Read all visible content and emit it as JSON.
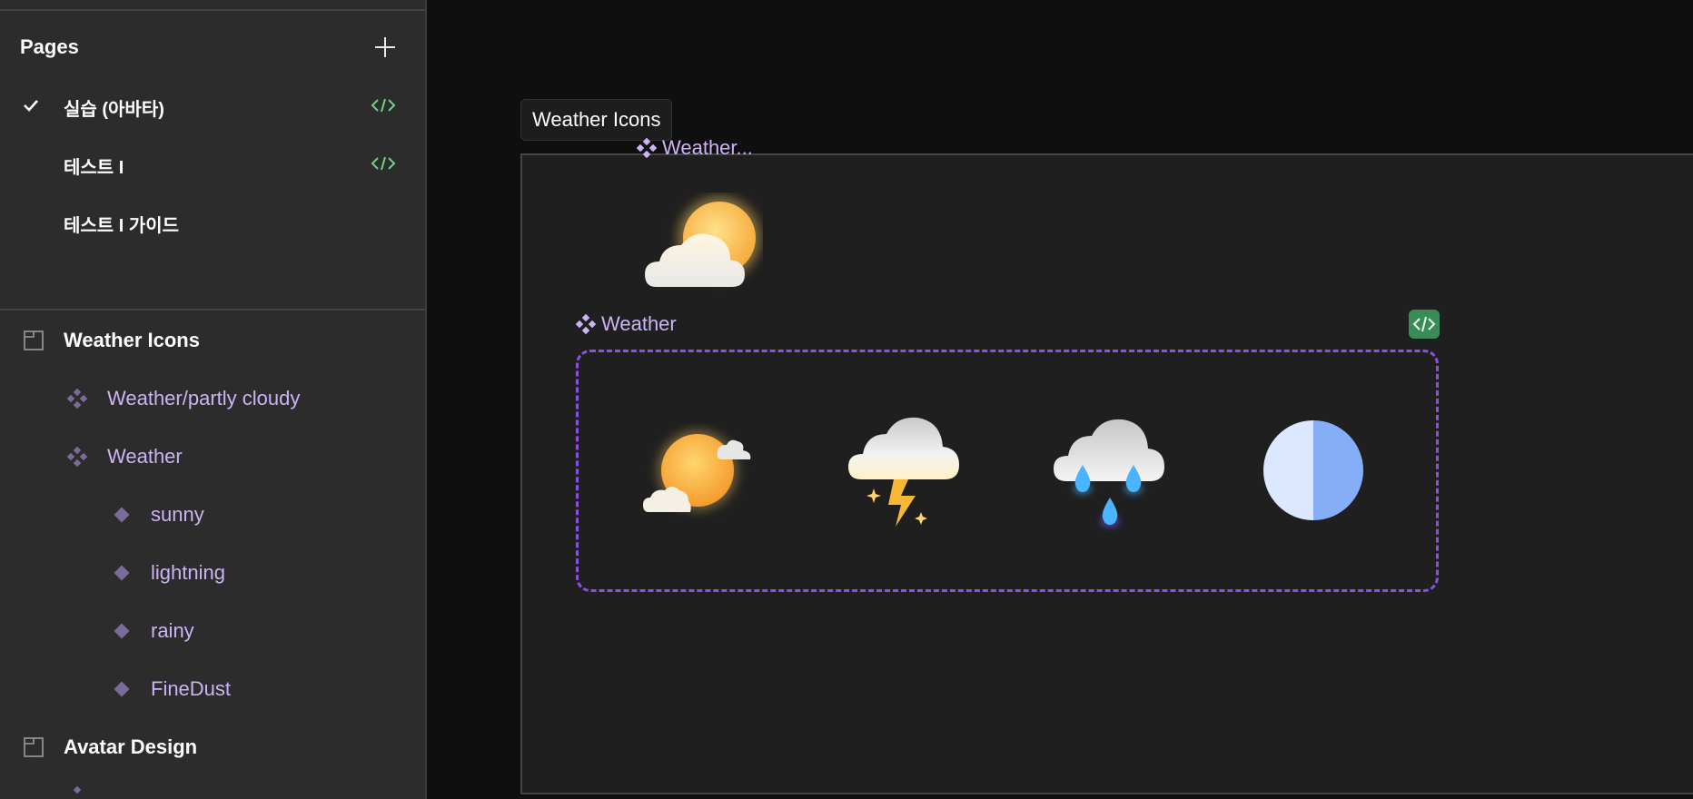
{
  "sidebar": {
    "pages_title": "Pages",
    "pages": [
      {
        "label": "실습 (아바타)",
        "active": true,
        "has_code": true
      },
      {
        "label": "테스트 I",
        "active": false,
        "has_code": true
      },
      {
        "label": "테스트 I 가이드",
        "active": false,
        "has_code": false
      }
    ],
    "layers": [
      {
        "type": "frame",
        "label": "Weather Icons"
      },
      {
        "type": "component",
        "label": "Weather/partly cloudy"
      },
      {
        "type": "component",
        "label": "Weather"
      },
      {
        "type": "variant",
        "label": "sunny"
      },
      {
        "type": "variant",
        "label": "lightning"
      },
      {
        "type": "variant",
        "label": "rainy"
      },
      {
        "type": "variant",
        "label": "FineDust"
      },
      {
        "type": "frame",
        "label": "Avatar Design"
      }
    ]
  },
  "canvas": {
    "frame_title": "Weather Icons",
    "partly_cloudy_label": "Weather...",
    "component_set_label": "Weather",
    "variants": [
      "sunny",
      "lightning",
      "rainy",
      "FineDust"
    ]
  },
  "colors": {
    "accent_purple": "#8a50e0",
    "component_text": "#cdb3f5",
    "code_green": "#3a8c57",
    "sun_orange": "#f6a93b",
    "rain_blue": "#4ab4ff"
  }
}
